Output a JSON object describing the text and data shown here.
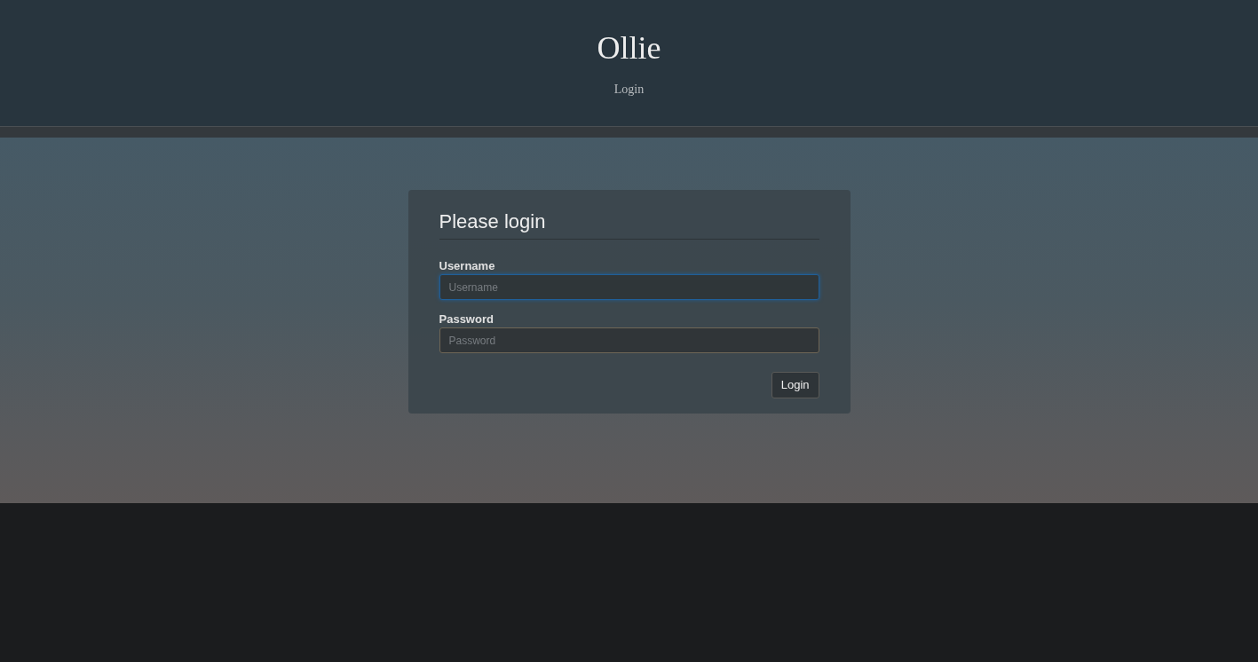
{
  "header": {
    "title": "Ollie",
    "nav": [
      {
        "label": "Login",
        "selected": false
      }
    ]
  },
  "login": {
    "heading": "Please login",
    "fields": [
      {
        "label": "Username",
        "placeholder": "Username",
        "focused": true
      },
      {
        "label": "Password",
        "placeholder": "Password",
        "focused": false
      }
    ],
    "button": "Login"
  }
}
